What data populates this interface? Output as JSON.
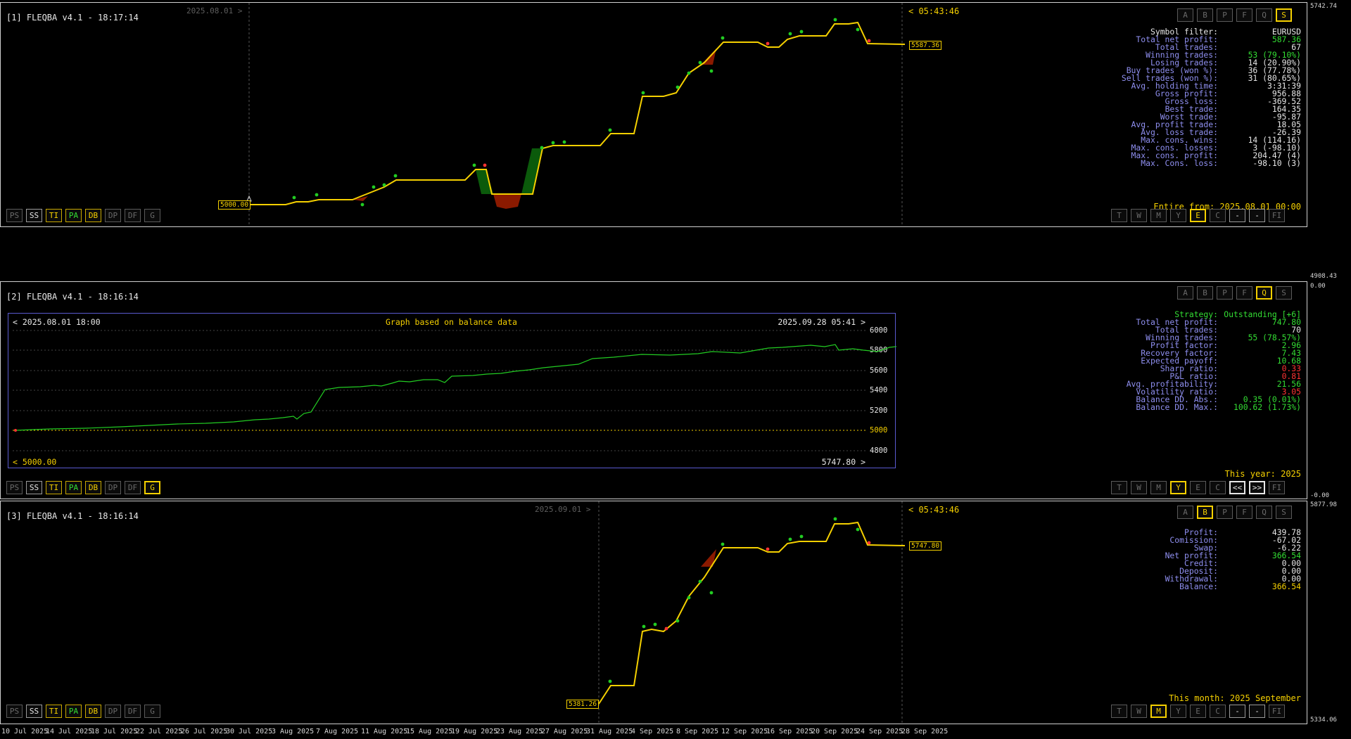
{
  "panels": [
    {
      "title": "[1] FLEQBA v4.1 - 18:17:14",
      "clock": "< 05:43:46",
      "date_marker": "2025.08.01 >",
      "top_buttons": [
        "A",
        "B",
        "P",
        "F",
        "Q",
        "S"
      ],
      "active_top": "S",
      "bottom_left_buttons": [
        "PS",
        "SS",
        "TI",
        "PA",
        "DB",
        "DP",
        "DF",
        "G"
      ],
      "bottom_right_buttons": [
        "T",
        "W",
        "M",
        "Y",
        "E",
        "C",
        "-",
        "-",
        "FI"
      ],
      "active_right": "E",
      "footnote": "Entire from: 2025.08.01 00:00",
      "start_label": "5000.00",
      "end_label": "5587.36",
      "stats": [
        {
          "label": "Symbol filter:",
          "value": "EURUSD",
          "lc": "white",
          "vc": "white"
        },
        {
          "label": "Total net profit:",
          "value": "587.36",
          "vc": "green"
        },
        {
          "label": "Total trades:",
          "value": "67"
        },
        {
          "label": "Winning trades:",
          "value": "53 (79.10%)",
          "vc": "green"
        },
        {
          "label": "Losing trades:",
          "value": "14 (20.90%)"
        },
        {
          "label": "Buy trades (won %):",
          "value": "36 (77.78%)"
        },
        {
          "label": "Sell trades (won %):",
          "value": "31 (80.65%)"
        },
        {
          "label": "Avg. holding time:",
          "value": "3:31:39"
        },
        {
          "label": "Gross profit:",
          "value": "956.88"
        },
        {
          "label": "Gross loss:",
          "value": "-369.52"
        },
        {
          "label": "Best trade:",
          "value": "164.35"
        },
        {
          "label": "Worst trade:",
          "value": "-95.87"
        },
        {
          "label": "Avg. profit trade:",
          "value": "18.05"
        },
        {
          "label": "Avg. loss trade:",
          "value": "-26.39"
        },
        {
          "label": "Max. cons. wins:",
          "value": "14 (114.16)"
        },
        {
          "label": "Max. cons. losses:",
          "value": "3 (-98.10)"
        },
        {
          "label": "Max. cons. profit:",
          "value": "204.47 (4)"
        },
        {
          "label": "Max. Cons. loss:",
          "value": "-98.10 (3)"
        }
      ],
      "axis_top": "5742.74",
      "axis_bottom": "4908.43"
    },
    {
      "title": "[2] FLEQBA v4.1 - 18:16:14",
      "top_buttons": [
        "A",
        "B",
        "P",
        "F",
        "Q",
        "S"
      ],
      "active_top": "Q",
      "bottom_left_buttons": [
        "PS",
        "SS",
        "TI",
        "PA",
        "DB",
        "DP",
        "DF",
        "G"
      ],
      "bottom_right_buttons": [
        "T",
        "W",
        "M",
        "Y",
        "E",
        "C",
        "<<",
        ">>",
        "FI"
      ],
      "active_right": "Y",
      "footnote": "This year: 2025",
      "stats": [
        {
          "label": "Strategy:",
          "value": "Outstanding [+6]",
          "lc": "green",
          "vc": "green"
        },
        {
          "label": "Total net profit:",
          "value": "747.80",
          "vc": "green"
        },
        {
          "label": "Total trades:",
          "value": "70"
        },
        {
          "label": "Winning trades:",
          "value": "55 (78.57%)",
          "vc": "green"
        },
        {
          "label": "Profit factor:",
          "value": "2.96",
          "vc": "green"
        },
        {
          "label": "Recovery factor:",
          "value": "7.43",
          "vc": "green"
        },
        {
          "label": "Expected payoff:",
          "value": "10.68",
          "vc": "green"
        },
        {
          "label": "Sharp ratio:",
          "value": "0.33",
          "vc": "red"
        },
        {
          "label": "P&L ratio:",
          "value": "0.81",
          "vc": "red"
        },
        {
          "label": "Avg. profitability:",
          "value": "21.56",
          "vc": "green"
        },
        {
          "label": "Volatility ratio:",
          "value": "3.05",
          "vc": "red"
        },
        {
          "label": "Balance DD. Abs.:",
          "value": "0.35 (0.01%)",
          "vc": "green"
        },
        {
          "label": "Balance DD. Max.:",
          "value": "100.62 (1.73%)",
          "vc": "green"
        }
      ],
      "graph": {
        "left_date": "< 2025.08.01 18:00",
        "title": "Graph based on balance data",
        "right_date": "2025.09.28 05:41 >",
        "left_value": "< 5000.00",
        "right_value": "5747.80 >",
        "yticks": [
          "6000",
          "5800",
          "5600",
          "5400",
          "5200",
          "5000",
          "4800"
        ]
      },
      "axis_top": "0.00",
      "axis_bottom": "-0.00"
    },
    {
      "title": "[3] FLEQBA v4.1 - 18:16:14",
      "clock": "< 05:43:46",
      "date_marker": "2025.09.01 >",
      "top_buttons": [
        "A",
        "B",
        "P",
        "F",
        "Q",
        "S"
      ],
      "active_top": "B",
      "bottom_left_buttons": [
        "PS",
        "SS",
        "TI",
        "PA",
        "DB",
        "DP",
        "DF",
        "G"
      ],
      "bottom_right_buttons": [
        "T",
        "W",
        "M",
        "Y",
        "E",
        "C",
        "-",
        "-",
        "FI"
      ],
      "active_right": "M",
      "footnote": "This month: 2025 September",
      "start_label": "5381.26",
      "end_label": "5747.80",
      "stats": [
        {
          "label": "Profit:",
          "value": "439.78"
        },
        {
          "label": "Comission:",
          "value": "-67.02"
        },
        {
          "label": "Swap:",
          "value": "-6.22"
        },
        {
          "label": "Net profit:",
          "value": "366.54",
          "vc": "green"
        },
        {
          "label": "Credit:",
          "value": "0.00"
        },
        {
          "label": "Deposit:",
          "value": "0.00"
        },
        {
          "label": "Withdrawal:",
          "value": "0.00"
        },
        {
          "label": "Balance:",
          "value": "366.54",
          "vc": "yellow"
        }
      ],
      "axis_top": "5877.98",
      "axis_bottom": "5334.06"
    }
  ],
  "x_axis": [
    "10 Jul 2025",
    "14 Jul 2025",
    "18 Jul 2025",
    "22 Jul 2025",
    "26 Jul 2025",
    "30 Jul 2025",
    "3 Aug 2025",
    "7 Aug 2025",
    "11 Aug 2025",
    "15 Aug 2025",
    "19 Aug 2025",
    "23 Aug 2025",
    "27 Aug 2025",
    "31 Aug 2025",
    "4 Sep 2025",
    "8 Sep 2025",
    "12 Sep 2025",
    "16 Sep 2025",
    "20 Sep 2025",
    "24 Sep 2025",
    "28 Sep 2025"
  ],
  "colors": {
    "equity": "#f5d000",
    "win": "#22cc22",
    "loss": "#ff3333",
    "balance_line": "#22cc22",
    "drawdown": "#8b1a00",
    "runup": "#0b5a0b"
  }
}
